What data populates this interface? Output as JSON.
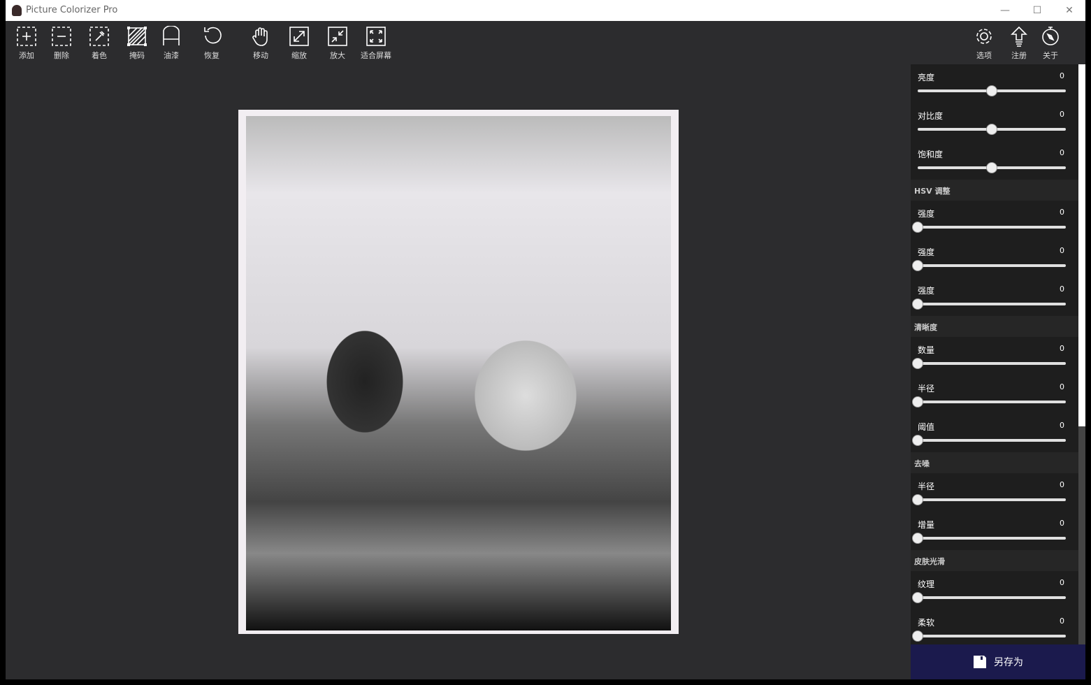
{
  "window": {
    "title": "Picture Colorizer Pro",
    "minimize": "—",
    "maximize": "☐",
    "close": "✕"
  },
  "toolbar": {
    "left": [
      {
        "id": "add",
        "label": "添加"
      },
      {
        "id": "delete",
        "label": "删除"
      },
      {
        "id": "colorize",
        "label": "着色"
      },
      {
        "id": "mask",
        "label": "掩码"
      },
      {
        "id": "paint",
        "label": "油漆"
      },
      {
        "id": "restore",
        "label": "恢复"
      },
      {
        "id": "move",
        "label": "移动"
      },
      {
        "id": "zoom",
        "label": "缩放"
      },
      {
        "id": "enlarge",
        "label": "放大"
      },
      {
        "id": "fit",
        "label": "适合屏幕"
      }
    ],
    "right": [
      {
        "id": "options",
        "label": "选项"
      },
      {
        "id": "register",
        "label": "注册"
      },
      {
        "id": "about",
        "label": "关于"
      }
    ]
  },
  "panel": {
    "basic": [
      {
        "label": "亮度",
        "value": "0",
        "pos": 0.5
      },
      {
        "label": "对比度",
        "value": "0",
        "pos": 0.5
      },
      {
        "label": "饱和度",
        "value": "0",
        "pos": 0.5
      }
    ],
    "sections": [
      {
        "title": "HSV 调整",
        "rows": [
          {
            "label": "强度",
            "value": "0",
            "pos": 0
          },
          {
            "label": "强度",
            "value": "0",
            "pos": 0
          },
          {
            "label": "强度",
            "value": "0",
            "pos": 0
          }
        ]
      },
      {
        "title": "清晰度",
        "rows": [
          {
            "label": "数量",
            "value": "0",
            "pos": 0
          },
          {
            "label": "半径",
            "value": "0",
            "pos": 0
          },
          {
            "label": "阈值",
            "value": "0",
            "pos": 0
          }
        ]
      },
      {
        "title": "去噪",
        "rows": [
          {
            "label": "半径",
            "value": "0",
            "pos": 0
          },
          {
            "label": "增量",
            "value": "0",
            "pos": 0
          }
        ]
      },
      {
        "title": "皮肤光滑",
        "rows": [
          {
            "label": "纹理",
            "value": "0",
            "pos": 0
          },
          {
            "label": "柔软",
            "value": "0",
            "pos": 0
          }
        ]
      }
    ]
  },
  "save": {
    "label": "另存为"
  }
}
